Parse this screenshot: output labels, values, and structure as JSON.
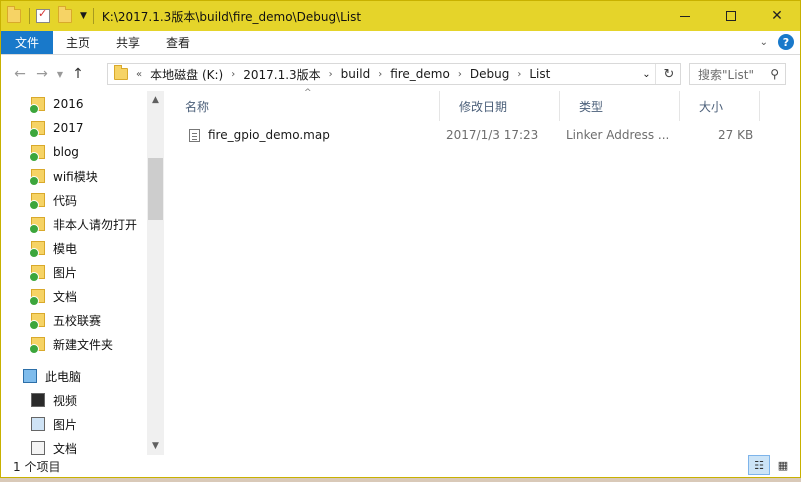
{
  "titlebar": {
    "path": "K:\\2017.1.3版本\\build\\fire_demo\\Debug\\List"
  },
  "ribbon": {
    "tabs": [
      "文件",
      "主页",
      "共享",
      "查看"
    ]
  },
  "address": {
    "overflow": "«",
    "crumbs": [
      "本地磁盘 (K:)",
      "2017.1.3版本",
      "build",
      "fire_demo",
      "Debug",
      "List"
    ]
  },
  "search": {
    "placeholder": "搜索\"List\""
  },
  "navpane": {
    "folders": [
      "2016",
      "2017",
      "blog",
      "wifi模块",
      "代码",
      "非本人请勿打开",
      "模电",
      "图片",
      "文档",
      "五校联赛",
      "新建文件夹"
    ],
    "this_pc": "此电脑",
    "pc_items": [
      "视频",
      "图片",
      "文档"
    ]
  },
  "columns": {
    "name": "名称",
    "date": "修改日期",
    "type": "类型",
    "size": "大小"
  },
  "files": [
    {
      "name": "fire_gpio_demo.map",
      "date": "2017/1/3 17:23",
      "type": "Linker Address ...",
      "size": "27 KB"
    }
  ],
  "status": {
    "count": "1 个项目"
  },
  "colors": {
    "titlebar": "#e5d42a",
    "file_tab": "#1979ca"
  }
}
